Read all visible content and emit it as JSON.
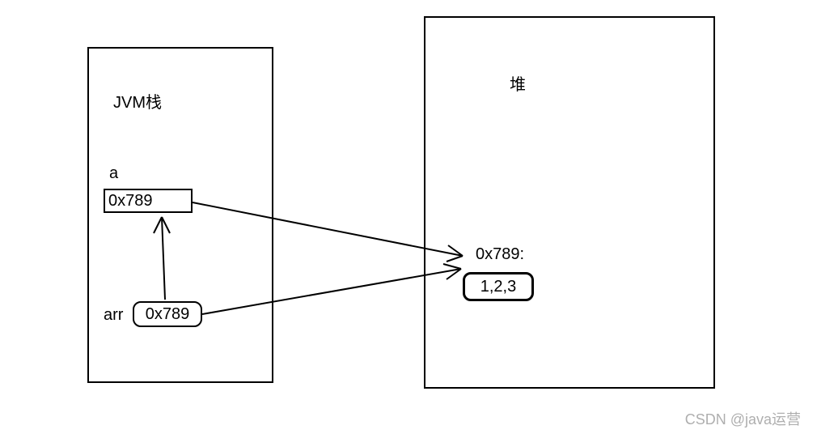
{
  "stack": {
    "title": "JVM栈",
    "var_a_label": "a",
    "var_a_value": "0x789",
    "var_arr_label": "arr",
    "var_arr_value": "0x789"
  },
  "heap": {
    "title": "堆",
    "address_label": "0x789:",
    "data_value": "1,2,3"
  },
  "watermark": "CSDN @java运营"
}
